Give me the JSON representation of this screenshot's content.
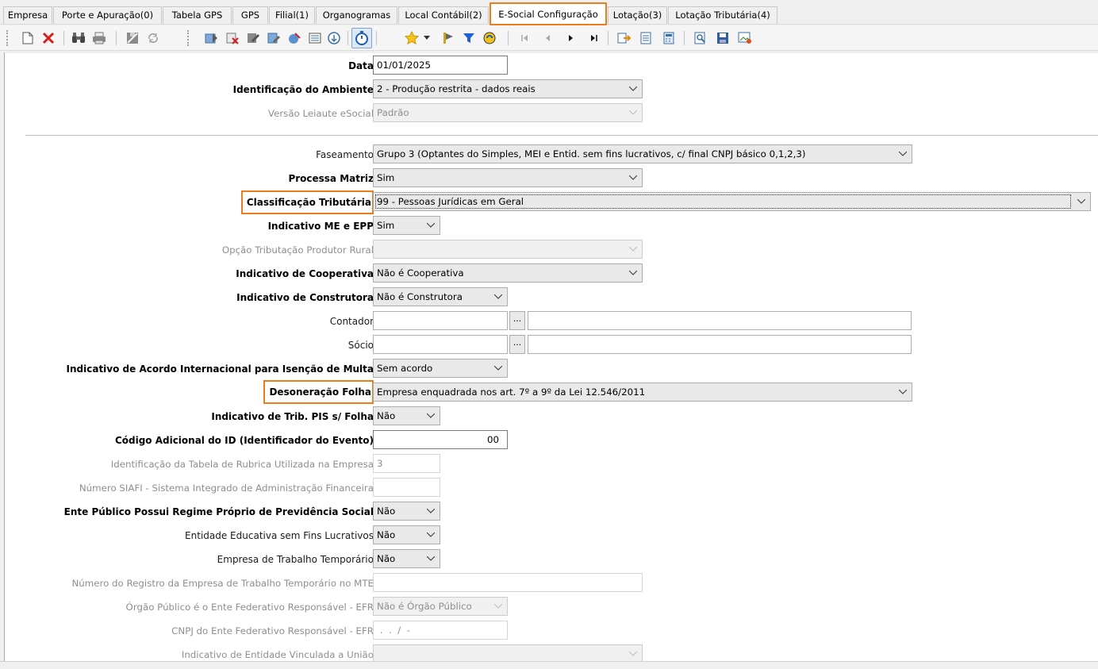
{
  "tabs": [
    {
      "label": "Empresa",
      "active": false
    },
    {
      "label": "Porte e Apuração(0)",
      "active": false
    },
    {
      "label": "Tabela GPS",
      "active": false
    },
    {
      "label": "GPS",
      "active": false
    },
    {
      "label": "Filial(1)",
      "active": false
    },
    {
      "label": "Organogramas",
      "active": false
    },
    {
      "label": "Local Contábil(2)",
      "active": false
    },
    {
      "label": "E-Social Configuração",
      "active": true
    },
    {
      "label": "Lotação(3)",
      "active": false
    },
    {
      "label": "Lotação Tributária(4)",
      "active": false
    }
  ],
  "toolbar": {
    "icons": [
      "new-icon",
      "delete-icon",
      "binoculars-icon",
      "print-icon",
      "save-icon",
      "refresh-icon",
      "tool-a-icon",
      "tool-b-icon",
      "tool-c-icon",
      "tool-d-icon",
      "tool-e-icon",
      "tool-f-icon",
      "tool-g-icon",
      "timer-icon",
      "star-icon",
      "dropdown-arrow-icon",
      "flag-icon",
      "filter-icon",
      "sync-icon",
      "first-record-icon",
      "previous-record-icon",
      "next-record-icon",
      "last-record-icon",
      "export-icon",
      "report-icon",
      "calculator-icon",
      "preview-icon",
      "save-as-icon",
      "image-icon"
    ]
  },
  "form": {
    "data": {
      "label": "Data",
      "value": "01/01/2025"
    },
    "ambiente": {
      "label": "Identificação do Ambiente",
      "value": "2 - Produção restrita - dados reais"
    },
    "versao": {
      "label": "Versão Leiaute eSocial",
      "value": "Padrão"
    },
    "faseamento": {
      "label": "Faseamento",
      "value": "Grupo 3 (Optantes do Simples, MEI e Entid. sem fins lucrativos, c/ final CNPJ básico 0,1,2,3)"
    },
    "processa_matriz": {
      "label": "Processa Matriz",
      "value": "Sim"
    },
    "classificacao": {
      "label": "Classificação Tributária",
      "value": "99 - Pessoas Jurídicas em Geral"
    },
    "me_epp": {
      "label": "Indicativo ME e EPP",
      "value": "Sim"
    },
    "produtor_rural": {
      "label": "Opção Tributação Produtor Rural",
      "value": ""
    },
    "cooperativa": {
      "label": "Indicativo de Cooperativa",
      "value": "Não é Cooperativa"
    },
    "construtora": {
      "label": "Indicativo de Construtora",
      "value": "Não é Construtora"
    },
    "contador": {
      "label": "Contador",
      "code": "",
      "name": "",
      "button": "..."
    },
    "socio": {
      "label": "Sócio",
      "code": "",
      "name": "",
      "button": "..."
    },
    "acordo": {
      "label": "Indicativo de Acordo Internacional para Isenção de Multa",
      "value": "Sem acordo"
    },
    "desoneracao": {
      "label": "Desoneração Folha",
      "value": "Empresa enquadrada nos art. 7º a 9º da Lei 12.546/2011"
    },
    "pis_folha": {
      "label": "Indicativo de Trib. PIS s/ Folha",
      "value": "Não"
    },
    "codigo_adicional": {
      "label": "Código Adicional do ID (Identificador do Evento)",
      "value": "00"
    },
    "tabela_rubrica": {
      "label": "Identificação da Tabela de Rubrica Utilizada na Empresa",
      "value": "3"
    },
    "siafi": {
      "label": "Número SIAFI - Sistema Integrado de Administração Financeira",
      "value": ""
    },
    "rpps": {
      "label": "Ente Público Possui Regime Próprio de Previdência Social",
      "value": "Não"
    },
    "educativa": {
      "label": "Entidade Educativa sem Fins Lucrativos",
      "value": "Não"
    },
    "trabalho_temp": {
      "label": "Empresa de Trabalho Temporário",
      "value": "Não"
    },
    "registro_mte": {
      "label": "Número do Registro da Empresa de Trabalho Temporário no MTE",
      "value": ""
    },
    "orgao_publico": {
      "label": "Órgão Público é o Ente Federativo Responsável - EFR",
      "value": "Não é Órgão Público"
    },
    "cnpj_efr": {
      "label": "CNPJ do Ente Federativo Responsável - EFR",
      "value": " .  .  /  -"
    },
    "vinculada_uniao": {
      "label": "Indicativo de Entidade Vinculada a União",
      "value": ""
    }
  },
  "colors": {
    "highlight": "#ee7b1c",
    "label_disabled": "#8e8e8e"
  }
}
